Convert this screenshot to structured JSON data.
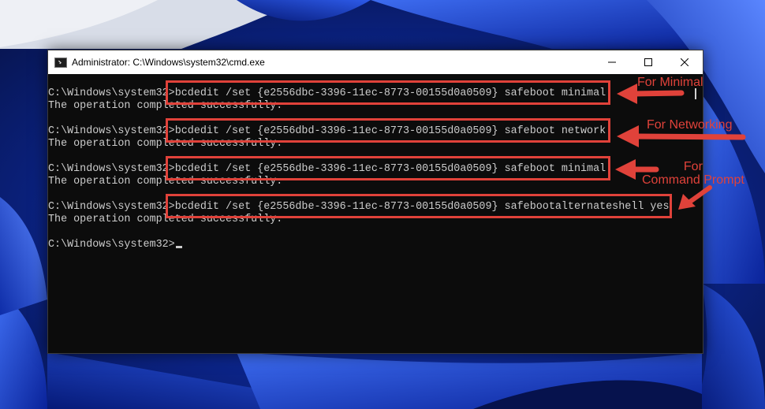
{
  "window": {
    "title": "Administrator: C:\\Windows\\system32\\cmd.exe",
    "icon": "console-icon"
  },
  "controls": {
    "minimize": "minimize-icon",
    "maximize": "maximize-icon",
    "close": "close-icon"
  },
  "console": {
    "prompt": "C:\\Windows\\system32>",
    "commands": [
      {
        "command": "bcdedit /set {e2556dbc-3396-11ec-8773-00155d0a0509} safeboot minimal",
        "result": "The operation completed successfully."
      },
      {
        "command": "bcdedit /set {e2556dbd-3396-11ec-8773-00155d0a0509} safeboot network",
        "result": "The operation completed successfully."
      },
      {
        "command": "bcdedit /set {e2556dbe-3396-11ec-8773-00155d0a0509} safeboot minimal",
        "result": "The operation completed successfully."
      },
      {
        "command": "bcdedit /set {e2556dbe-3396-11ec-8773-00155d0a0509} safebootalternateshell yes",
        "result": "The operation completed successfully."
      }
    ],
    "final_prompt": "C:\\Windows\\system32>"
  },
  "annotations": [
    {
      "label": "For Minimal"
    },
    {
      "label": "For Networking"
    },
    {
      "label": "For\nCommand Prompt"
    }
  ],
  "colors": {
    "annotation": "#e0423a",
    "console_text": "#cccccc",
    "console_bg": "#0c0c0c"
  }
}
